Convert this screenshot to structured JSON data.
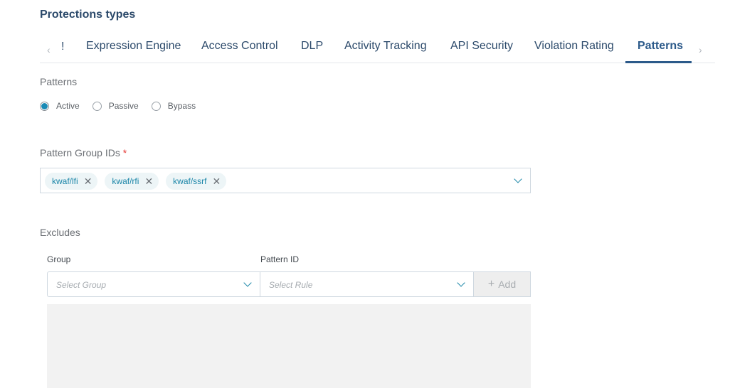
{
  "page": {
    "title": "Protections types"
  },
  "tabs": {
    "prev_icon": "‹",
    "next_icon": "›",
    "partial_tab": "!",
    "items": [
      {
        "label": "Expression Engine",
        "active": false
      },
      {
        "label": "Access Control",
        "active": false
      },
      {
        "label": "DLP",
        "active": false
      },
      {
        "label": "Activity Tracking",
        "active": false
      },
      {
        "label": "API Security",
        "active": false
      },
      {
        "label": "Violation Rating",
        "active": false
      },
      {
        "label": "Patterns",
        "active": true
      }
    ]
  },
  "patterns": {
    "label": "Patterns",
    "mode_options": [
      {
        "label": "Active",
        "checked": true
      },
      {
        "label": "Passive",
        "checked": false
      },
      {
        "label": "Bypass",
        "checked": false
      }
    ]
  },
  "pattern_group_ids": {
    "label": "Pattern Group IDs",
    "required_mark": "*",
    "selected": [
      {
        "label": "kwaf/lfi",
        "remove_icon": "✕"
      },
      {
        "label": "kwaf/rfi",
        "remove_icon": "✕"
      },
      {
        "label": "kwaf/ssrf",
        "remove_icon": "✕"
      }
    ]
  },
  "excludes": {
    "label": "Excludes",
    "group": {
      "label": "Group",
      "placeholder": "Select Group"
    },
    "pattern_id": {
      "label": "Pattern ID",
      "placeholder": "Select Rule"
    },
    "add_button": {
      "icon": "+",
      "label": "Add"
    },
    "items": []
  },
  "colors": {
    "primary": "#2c5a8a",
    "accent": "#1b86a8",
    "required": "#e53935"
  }
}
